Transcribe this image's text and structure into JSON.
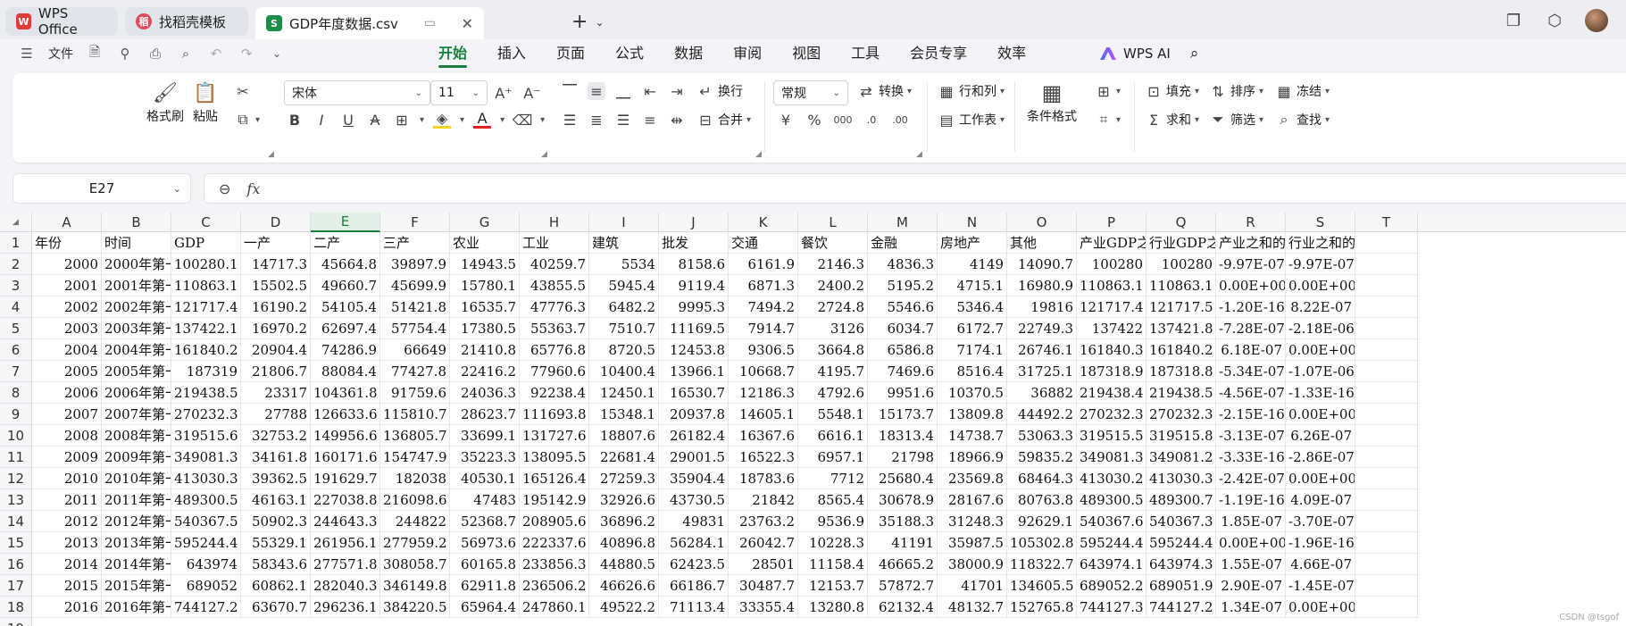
{
  "titlebar": {
    "tabs": [
      {
        "label": "WPS Office",
        "logo": "W",
        "color": "#e53935"
      },
      {
        "label": "找稻壳模板",
        "logo": "稻",
        "color": "#e5485d"
      },
      {
        "label": "GDP年度数据.csv",
        "logo": "S",
        "color": "#1a8f4a"
      }
    ]
  },
  "menubar": {
    "file_label": "文件",
    "tabs": [
      "开始",
      "插入",
      "页面",
      "公式",
      "数据",
      "审阅",
      "视图",
      "工具",
      "会员专享",
      "效率"
    ],
    "active_tab": "开始",
    "ai_label": "WPS AI"
  },
  "ribbon": {
    "format_painter": "格式刷",
    "paste": "粘贴",
    "font_name": "宋体",
    "font_size": "11",
    "wrap": "换行",
    "merge": "合并",
    "number_format": "常规",
    "convert": "转换",
    "rows_cols": "行和列",
    "worksheet": "工作表",
    "conditional_format": "条件格式",
    "fill": "填充",
    "sum": "求和",
    "sort": "排序",
    "filter": "筛选",
    "freeze": "冻结",
    "find": "查找"
  },
  "formula_bar": {
    "cell_ref": "E27",
    "fx": "fx",
    "content": ""
  },
  "grid": {
    "columns": [
      "A",
      "B",
      "C",
      "D",
      "E",
      "F",
      "G",
      "H",
      "I",
      "J",
      "K",
      "L",
      "M",
      "N",
      "O",
      "P",
      "Q",
      "R",
      "S",
      "T"
    ],
    "selected_column": "E",
    "header_row": [
      "年份",
      "时间",
      "GDP",
      "一产",
      "二产",
      "三产",
      "农业",
      "工业",
      "建筑",
      "批发",
      "交通",
      "餐饮",
      "金融",
      "房地产",
      "其他",
      "产业GDP之和",
      "行业GDP之和",
      "产业之和的误差",
      "行业之和的误差",
      ""
    ],
    "rows": [
      [
        "2000",
        "2000年第一",
        "100280.1",
        "14717.3",
        "45664.8",
        "39897.9",
        "14943.5",
        "40259.7",
        "5534",
        "8158.6",
        "6161.9",
        "2146.3",
        "4836.3",
        "4149",
        "14090.7",
        "100280",
        "100280",
        "-9.97E-07",
        "-9.97E-07"
      ],
      [
        "2001",
        "2001年第一",
        "110863.1",
        "15502.5",
        "49660.7",
        "45699.9",
        "15780.1",
        "43855.5",
        "5945.4",
        "9119.4",
        "6871.3",
        "2400.2",
        "5195.2",
        "4715.1",
        "16980.9",
        "110863.1",
        "110863.1",
        "0.00E+00",
        "0.00E+00"
      ],
      [
        "2002",
        "2002年第一",
        "121717.4",
        "16190.2",
        "54105.4",
        "51421.8",
        "16535.7",
        "47776.3",
        "6482.2",
        "9995.3",
        "7494.2",
        "2724.8",
        "5546.6",
        "5346.4",
        "19816",
        "121717.4",
        "121717.5",
        "-1.20E-16",
        "8.22E-07"
      ],
      [
        "2003",
        "2003年第一",
        "137422.1",
        "16970.2",
        "62697.4",
        "57754.4",
        "17380.5",
        "55363.7",
        "7510.7",
        "11169.5",
        "7914.7",
        "3126",
        "6034.7",
        "6172.7",
        "22749.3",
        "137422",
        "137421.8",
        "-7.28E-07",
        "-2.18E-06"
      ],
      [
        "2004",
        "2004年第一",
        "161840.2",
        "20904.4",
        "74286.9",
        "66649",
        "21410.8",
        "65776.8",
        "8720.5",
        "12453.8",
        "9306.5",
        "3664.8",
        "6586.8",
        "7174.1",
        "26746.1",
        "161840.3",
        "161840.2",
        "6.18E-07",
        "0.00E+00"
      ],
      [
        "2005",
        "2005年第一",
        "187319",
        "21806.7",
        "88084.4",
        "77427.8",
        "22416.2",
        "77960.6",
        "10400.4",
        "13966.1",
        "10668.7",
        "4195.7",
        "7469.6",
        "8516.4",
        "31725.1",
        "187318.9",
        "187318.8",
        "-5.34E-07",
        "-1.07E-06"
      ],
      [
        "2006",
        "2006年第一",
        "219438.5",
        "23317",
        "104361.8",
        "91759.6",
        "24036.3",
        "92238.4",
        "12450.1",
        "16530.7",
        "12186.3",
        "4792.6",
        "9951.6",
        "10370.5",
        "36882",
        "219438.4",
        "219438.5",
        "-4.56E-07",
        "-1.33E-16"
      ],
      [
        "2007",
        "2007年第一",
        "270232.3",
        "27788",
        "126633.6",
        "115810.7",
        "28623.7",
        "111693.8",
        "15348.1",
        "20937.8",
        "14605.1",
        "5548.1",
        "15173.7",
        "13809.8",
        "44492.2",
        "270232.3",
        "270232.3",
        "-2.15E-16",
        "0.00E+00"
      ],
      [
        "2008",
        "2008年第一",
        "319515.6",
        "32753.2",
        "149956.6",
        "136805.7",
        "33699.1",
        "131727.6",
        "18807.6",
        "26182.4",
        "16367.6",
        "6616.1",
        "18313.4",
        "14738.7",
        "53063.3",
        "319515.5",
        "319515.8",
        "-3.13E-07",
        "6.26E-07"
      ],
      [
        "2009",
        "2009年第一",
        "349081.3",
        "34161.8",
        "160171.6",
        "154747.9",
        "35223.3",
        "138095.5",
        "22681.4",
        "29001.5",
        "16522.3",
        "6957.1",
        "21798",
        "18966.9",
        "59835.2",
        "349081.3",
        "349081.2",
        "-3.33E-16",
        "-2.86E-07"
      ],
      [
        "2010",
        "2010年第一",
        "413030.3",
        "39362.5",
        "191629.7",
        "182038",
        "40530.1",
        "165126.4",
        "27259.3",
        "35904.4",
        "18783.6",
        "7712",
        "25680.4",
        "23569.8",
        "68464.3",
        "413030.2",
        "413030.3",
        "-2.42E-07",
        "0.00E+00"
      ],
      [
        "2011",
        "2011年第一",
        "489300.5",
        "46163.1",
        "227038.8",
        "216098.6",
        "47483",
        "195142.9",
        "32926.6",
        "43730.5",
        "21842",
        "8565.4",
        "30678.9",
        "28167.6",
        "80763.8",
        "489300.5",
        "489300.7",
        "-1.19E-16",
        "4.09E-07"
      ],
      [
        "2012",
        "2012年第一",
        "540367.5",
        "50902.3",
        "244643.3",
        "244822",
        "52368.7",
        "208905.6",
        "36896.2",
        "49831",
        "23763.2",
        "9536.9",
        "35188.3",
        "31248.3",
        "92629.1",
        "540367.6",
        "540367.3",
        "1.85E-07",
        "-3.70E-07"
      ],
      [
        "2013",
        "2013年第一",
        "595244.4",
        "55329.1",
        "261956.1",
        "277959.2",
        "56973.6",
        "222337.6",
        "40896.8",
        "56284.1",
        "26042.7",
        "10228.3",
        "41191",
        "35987.5",
        "105302.8",
        "595244.4",
        "595244.4",
        "0.00E+00",
        "-1.96E-16"
      ],
      [
        "2014",
        "2014年第一",
        "643974",
        "58343.6",
        "277571.8",
        "308058.7",
        "60165.8",
        "233856.3",
        "44880.5",
        "62423.5",
        "28501",
        "11158.4",
        "46665.2",
        "38000.9",
        "118322.7",
        "643974.1",
        "643974.3",
        "1.55E-07",
        "4.66E-07"
      ],
      [
        "2015",
        "2015年第一",
        "689052",
        "60862.1",
        "282040.3",
        "346149.8",
        "62911.8",
        "236506.2",
        "46626.6",
        "66186.7",
        "30487.7",
        "12153.7",
        "57872.7",
        "41701",
        "134605.5",
        "689052.2",
        "689051.9",
        "2.90E-07",
        "-1.45E-07"
      ],
      [
        "2016",
        "2016年第一",
        "744127.2",
        "63670.7",
        "296236.1",
        "384220.5",
        "65964.4",
        "247860.1",
        "49522.2",
        "71113.4",
        "33355.4",
        "13280.8",
        "62132.4",
        "48132.7",
        "152765.8",
        "744127.3",
        "744127.2",
        "1.34E-07",
        "0.00E+00"
      ]
    ],
    "watermark": "CSDN @tsgof"
  }
}
